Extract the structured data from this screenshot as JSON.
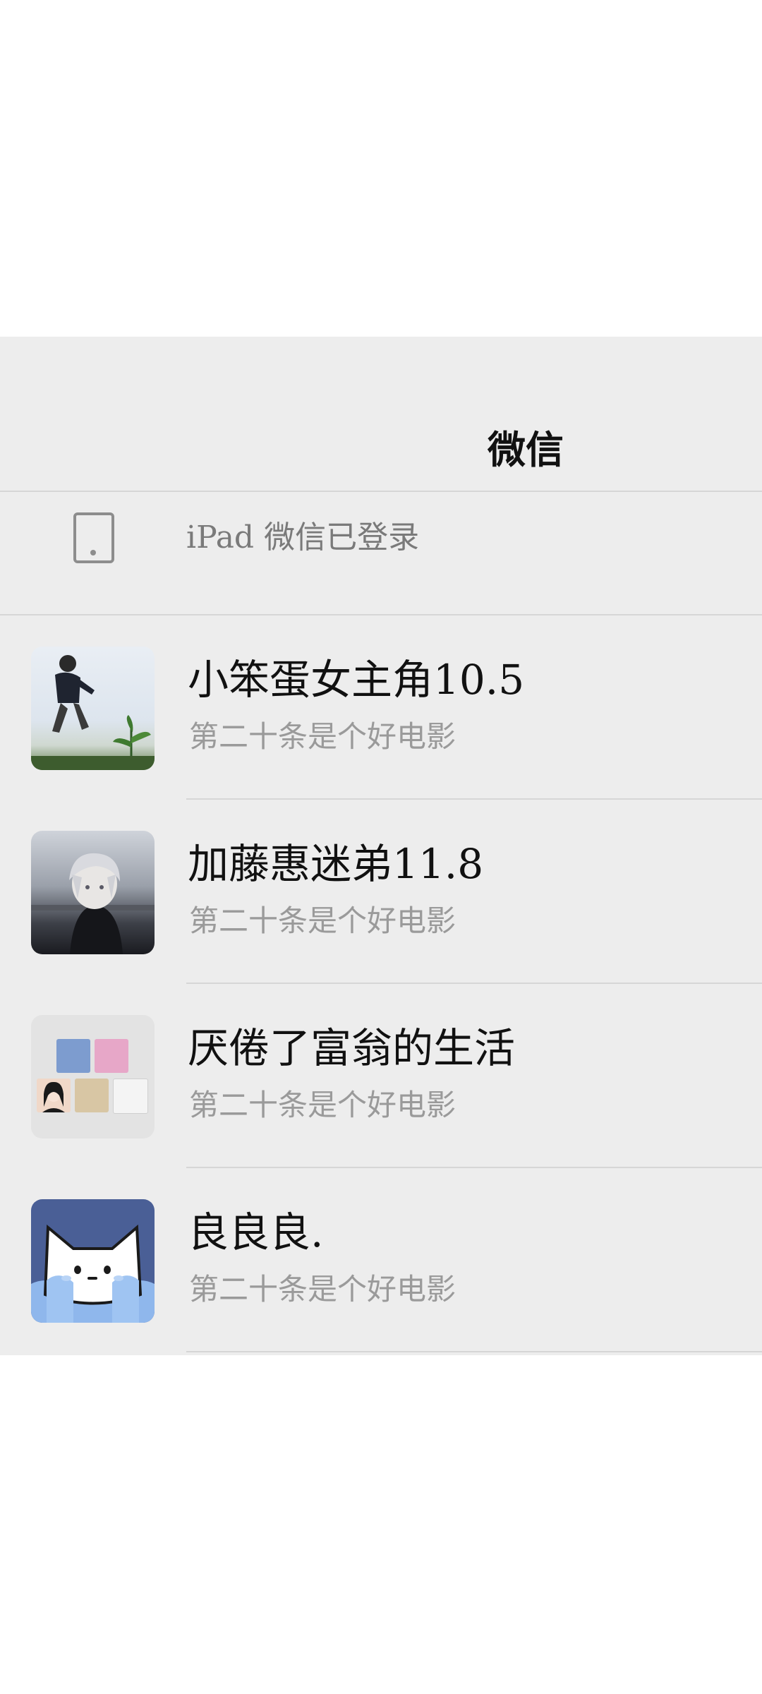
{
  "header": {
    "title": "微信"
  },
  "device_banner": {
    "text": "iPad 微信已登录",
    "icon": "tablet-icon"
  },
  "chats": [
    {
      "name": "小笨蛋女主角10.5",
      "preview": "第二十条是个好电影",
      "avatar": "runner-photo"
    },
    {
      "name": "加藤惠迷弟11.8",
      "preview": "第二十条是个好电影",
      "avatar": "anime-boy-avatar"
    },
    {
      "name": "厌倦了富翁的生活",
      "preview": "第二十条是个好电影",
      "avatar": "group-collage-avatar"
    },
    {
      "name": "良良良.",
      "preview": "第二十条是个好电影",
      "avatar": "cat-avatar"
    }
  ]
}
